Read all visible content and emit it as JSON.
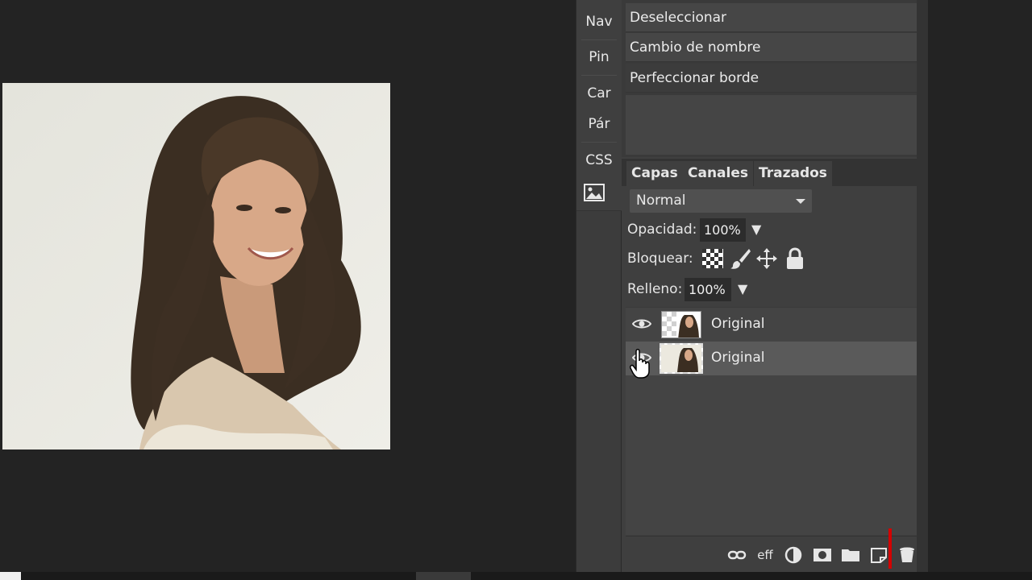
{
  "side_tabs": [
    "Nav",
    "Pin",
    "Car",
    "Pár",
    "CSS"
  ],
  "menu": {
    "items": [
      "Deseleccionar",
      "Cambio de nombre",
      "Perfeccionar borde"
    ]
  },
  "layers_panel": {
    "tabs": [
      "Capas",
      "Canales",
      "Trazados"
    ],
    "blend_mode": "Normal",
    "opacity_label": "Opacidad:",
    "opacity_value": "100%",
    "lock_label": "Bloquear:",
    "fill_label": "Relleno:",
    "fill_value": "100%",
    "layers": [
      {
        "name": "Original",
        "visible": true,
        "selected": false
      },
      {
        "name": "Original",
        "visible": true,
        "selected": true
      }
    ],
    "footer_icons": [
      "link-icon",
      "eff",
      "adjustment-icon",
      "mask-icon",
      "folder-icon",
      "new-layer-icon",
      "trash-icon"
    ],
    "footer_eff_label": "eff"
  },
  "colors": {
    "background": "#232323",
    "panel": "#3f3f3f",
    "selected_row": "#5a5a5a",
    "marker": "#d40000"
  }
}
